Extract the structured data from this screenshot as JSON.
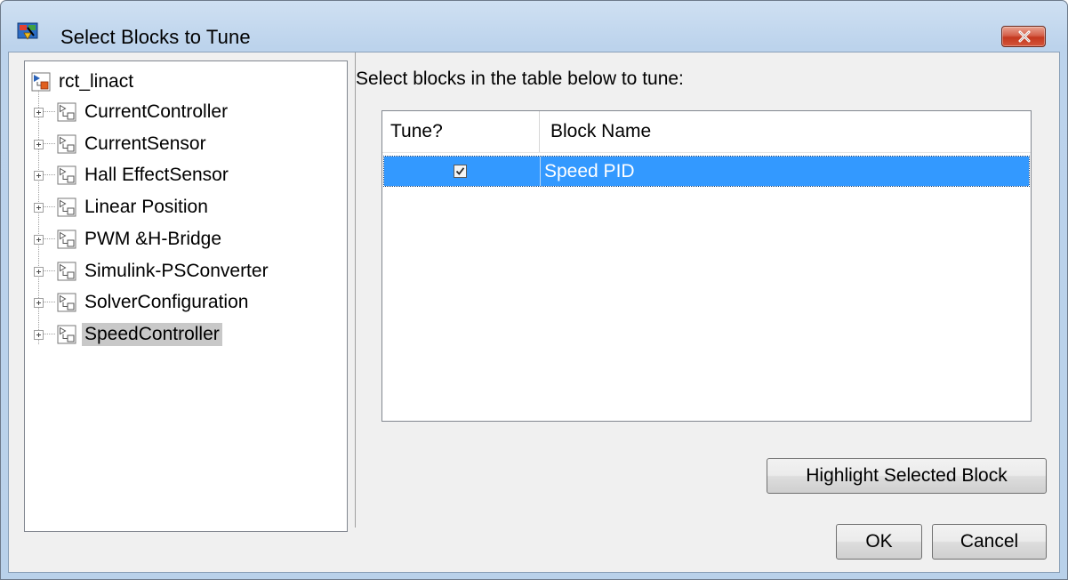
{
  "window": {
    "title": "Select Blocks to Tune",
    "close_icon": "close-x-icon"
  },
  "tree": {
    "root": {
      "label": "rct_linact",
      "icon": "model-icon"
    },
    "items": [
      {
        "label": "CurrentController",
        "icon": "subsystem-icon",
        "selected": false
      },
      {
        "label": "CurrentSensor",
        "icon": "subsystem-icon",
        "selected": false
      },
      {
        "label": "Hall EffectSensor",
        "icon": "subsystem-icon",
        "selected": false
      },
      {
        "label": "Linear Position",
        "icon": "subsystem-icon",
        "selected": false
      },
      {
        "label": "PWM &H-Bridge",
        "icon": "subsystem-icon",
        "selected": false
      },
      {
        "label": "Simulink-PSConverter",
        "icon": "subsystem-icon",
        "selected": false
      },
      {
        "label": "SolverConfiguration",
        "icon": "subsystem-icon",
        "selected": false
      },
      {
        "label": "SpeedController",
        "icon": "subsystem-icon",
        "selected": true
      }
    ]
  },
  "main": {
    "instruction": "Select blocks in the table below to tune:",
    "table": {
      "columns": [
        "Tune?",
        "Block Name"
      ],
      "rows": [
        {
          "tune": true,
          "block_name": "Speed PID",
          "selected": true
        }
      ]
    }
  },
  "buttons": {
    "highlight": "Highlight Selected Block",
    "ok": "OK",
    "cancel": "Cancel"
  },
  "colors": {
    "selection": "#3399ff",
    "tree_selection": "#c8c8c8",
    "close_button": "#c4391f"
  }
}
